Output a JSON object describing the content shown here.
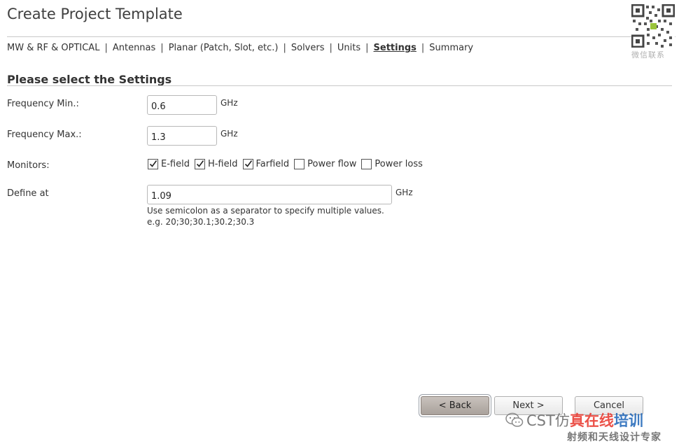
{
  "window": {
    "title": "Create Project Template"
  },
  "breadcrumb": {
    "items": [
      {
        "label": "MW & RF & OPTICAL",
        "current": false
      },
      {
        "label": "Antennas",
        "current": false
      },
      {
        "label": "Planar (Patch, Slot, etc.)",
        "current": false
      },
      {
        "label": "Solvers",
        "current": false
      },
      {
        "label": "Units",
        "current": false
      },
      {
        "label": "Settings",
        "current": true
      },
      {
        "label": "Summary",
        "current": false
      }
    ],
    "separator": "|"
  },
  "settings": {
    "section_title": "Please select the Settings",
    "freq_min": {
      "label": "Frequency Min.:",
      "value": "0.6",
      "unit": "GHz"
    },
    "freq_max": {
      "label": "Frequency Max.:",
      "value": "1.3",
      "unit": "GHz"
    },
    "monitors": {
      "label": "Monitors:",
      "items": [
        {
          "label": "E-field",
          "checked": true
        },
        {
          "label": "H-field",
          "checked": true
        },
        {
          "label": "Farfield",
          "checked": true
        },
        {
          "label": "Power flow",
          "checked": false
        },
        {
          "label": "Power loss",
          "checked": false
        }
      ]
    },
    "define_at": {
      "label": "Define at",
      "value": "1.09",
      "unit": "GHz",
      "hint_line1": "Use semicolon as a separator to specify multiple values.",
      "hint_line2": "e.g. 20;30;30.1;30.2;30.3"
    }
  },
  "buttons": {
    "back": "< Back",
    "next": "Next >",
    "cancel": "Cancel"
  },
  "watermark": {
    "qr_caption": "微信联系",
    "brand_prefix": "CST仿",
    "brand_red": "真在线",
    "brand_blue": "培训",
    "tagline": "射频和天线设计专家"
  },
  "colors": {
    "accent_red": "#e8342a",
    "accent_blue": "#1c63b7",
    "back_button": "#b3aba5"
  }
}
